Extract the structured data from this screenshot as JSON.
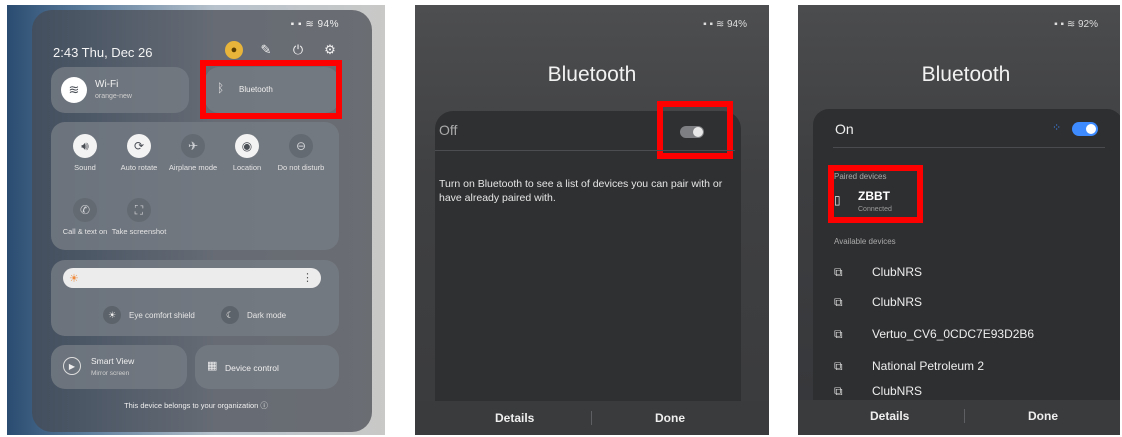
{
  "panel1": {
    "status_text": "94%",
    "clock": "2:43  Thu, Dec 26",
    "top_icons": [
      "user-icon",
      "pencil-icon",
      "power-icon",
      "gear-icon"
    ],
    "wifi": {
      "label": "Wi-Fi",
      "network": "orange-new"
    },
    "bluetooth": {
      "label": "Bluetooth"
    },
    "grid": [
      {
        "label": "Sound",
        "icon": "sound-icon"
      },
      {
        "label": "Auto rotate",
        "icon": "rotate-icon"
      },
      {
        "label": "Airplane mode",
        "icon": "airplane-icon"
      },
      {
        "label": "Location",
        "icon": "location-icon"
      },
      {
        "label": "Do not disturb",
        "icon": "do-not-disturb-icon"
      },
      {
        "label": "Call & text on",
        "icon": "call-icon"
      },
      {
        "label": "Take screenshot",
        "icon": "screenshot-icon"
      }
    ],
    "eye_comfort": "Eye comfort shield",
    "dark_mode": "Dark mode",
    "smart_view": {
      "label": "Smart View",
      "sub": "Mirror screen"
    },
    "device_control": "Device control",
    "footer": "This device belongs to your organization"
  },
  "panel2": {
    "status_text": "94%",
    "title": "Bluetooth",
    "state": "Off",
    "message": "Turn on Bluetooth to see a list of devices you can pair with or have already paired with.",
    "details": "Details",
    "done": "Done"
  },
  "panel3": {
    "status_text": "92%",
    "title": "Bluetooth",
    "state": "On",
    "paired_header": "Paired devices",
    "paired": {
      "name": "ZBBT",
      "sub": "Connected"
    },
    "available_header": "Available devices",
    "available": [
      "ClubNRS",
      "ClubNRS",
      "Vertuo_CV6_0CDC7E93D2B6",
      "National Petroleum 2",
      "ClubNRS"
    ],
    "details": "Details",
    "done": "Done"
  },
  "colors": {
    "highlight": "#ff0000",
    "toggle_on": "#3d8bff",
    "accent_user": "#e8b53a"
  }
}
